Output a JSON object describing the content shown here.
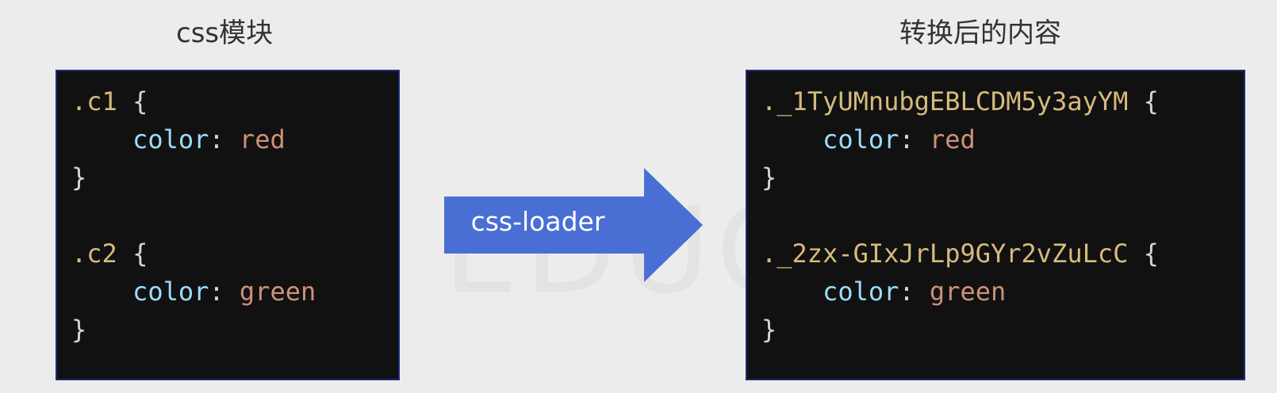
{
  "titles": {
    "left": "css模块",
    "right": "转换后的内容"
  },
  "arrow": {
    "label": "css-loader",
    "color": "#4a6fd4"
  },
  "left_code": {
    "rule1": {
      "selector": ".c1",
      "property": "color",
      "value": "red"
    },
    "rule2": {
      "selector": ".c2",
      "property": "color",
      "value": "green"
    }
  },
  "right_code": {
    "rule1": {
      "selector": "._1TyUMnubgEBLCDM5y3ayYM",
      "property": "color",
      "value": "red"
    },
    "rule2": {
      "selector": "._2zx-GIxJrLp9GYr2vZuLcC",
      "property": "color",
      "value": "green"
    }
  },
  "syntax": {
    "open_brace": "{",
    "close_brace": "}",
    "colon": ":"
  },
  "watermark": "DUYI EDUCATION"
}
